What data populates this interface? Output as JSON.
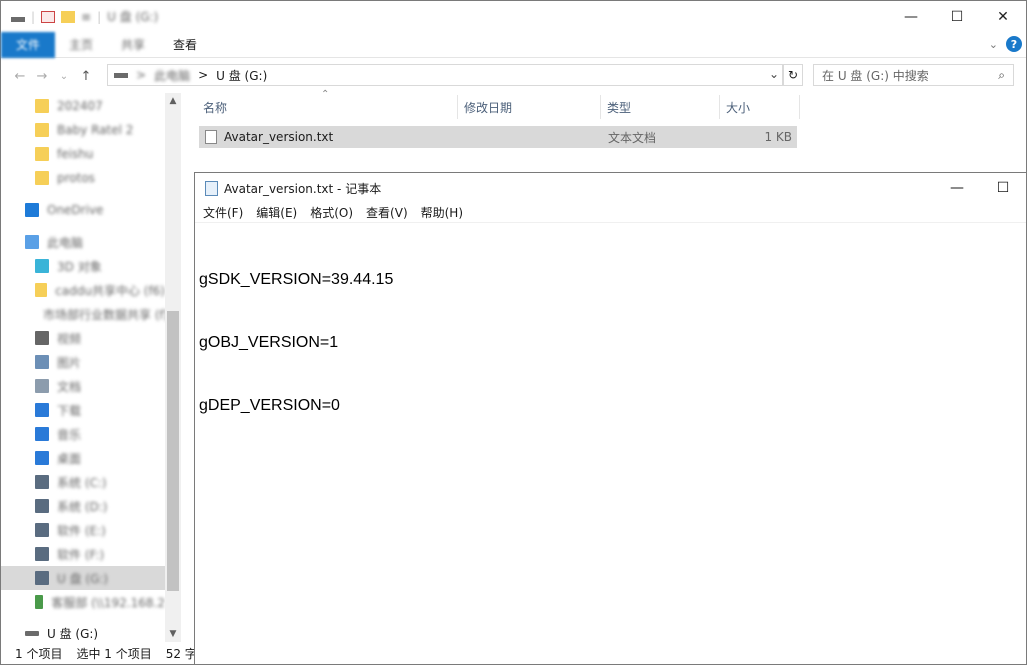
{
  "explorer": {
    "title_blurred": "U 盘 (G:)",
    "window_controls": {
      "minimize": "—",
      "maximize": "☐",
      "close": "✕"
    },
    "ribbon": {
      "tabs": [
        "文件",
        "主页",
        "共享",
        "查看"
      ]
    },
    "nav": {
      "back": "←",
      "forward": "→",
      "up_list": "⌄",
      "up": "↑"
    },
    "address": {
      "path_blurred": "此电脑",
      "current": "U 盘 (G:)",
      "separator": ">"
    },
    "search": {
      "placeholder": "在 U 盘 (G:) 中搜索"
    },
    "sidebar": {
      "items": [
        {
          "label": "202407",
          "icon": "folder-icon",
          "color": "#f6cf58"
        },
        {
          "label": "Baby Ratel 2",
          "icon": "folder-icon",
          "color": "#f6cf58"
        },
        {
          "label": "feishu",
          "icon": "folder-icon",
          "color": "#f6cf58"
        },
        {
          "label": "protos",
          "icon": "folder-icon",
          "color": "#f6cf58"
        },
        {
          "label": "OneDrive",
          "icon": "cloud-icon",
          "color": "#1e7bd8"
        },
        {
          "label": "此电脑",
          "icon": "computer-icon",
          "color": "#5aa0e6"
        },
        {
          "label": "3D 对象",
          "icon": "cube-icon",
          "color": "#3ab4d8"
        },
        {
          "label": "caddu共享中心 (f6)",
          "icon": "folder-icon",
          "color": "#f6cf58"
        },
        {
          "label": "市场部行业数据共享 (f)",
          "icon": "folder-icon",
          "color": "#f6cf58"
        },
        {
          "label": "视频",
          "icon": "video-icon",
          "color": "#666666"
        },
        {
          "label": "图片",
          "icon": "picture-icon",
          "color": "#6c8fb6"
        },
        {
          "label": "文档",
          "icon": "document-icon",
          "color": "#8c9cad"
        },
        {
          "label": "下载",
          "icon": "download-icon",
          "color": "#2a7ad8"
        },
        {
          "label": "音乐",
          "icon": "music-icon",
          "color": "#2a7ad8"
        },
        {
          "label": "桌面",
          "icon": "desktop-icon",
          "color": "#2a7ad8"
        },
        {
          "label": "系统 (C:)",
          "icon": "drive-icon",
          "color": "#5a6c80"
        },
        {
          "label": "系统 (D:)",
          "icon": "drive-icon",
          "color": "#5a6c80"
        },
        {
          "label": "软件 (E:)",
          "icon": "drive-icon",
          "color": "#5a6c80"
        },
        {
          "label": "软件 (F:)",
          "icon": "drive-icon",
          "color": "#5a6c80"
        },
        {
          "label": "U 盘 (G:)",
          "icon": "usb-drive-icon",
          "color": "#5a6c80"
        },
        {
          "label": "客服部 (\\\\192.168.2",
          "icon": "network-drive-icon",
          "color": "#4a9a4a"
        }
      ],
      "bottom_item": "U 盘 (G:)"
    },
    "columns": [
      "名称",
      "修改日期",
      "类型",
      "大小"
    ],
    "file": {
      "name": "Avatar_version.txt",
      "date": "",
      "type": "文本文档",
      "size": "1 KB"
    },
    "status": {
      "count": "1 个项目",
      "selected": "选中 1 个项目",
      "size": "52 字"
    }
  },
  "notepad": {
    "title": "Avatar_version.txt - 记事本",
    "menu": [
      "文件(F)",
      "编辑(E)",
      "格式(O)",
      "查看(V)",
      "帮助(H)"
    ],
    "lines": [
      "gSDK_VERSION=39.44.15",
      "gOBJ_VERSION=1",
      "gDEP_VERSION=0"
    ],
    "window_controls": {
      "minimize": "—",
      "maximize": "☐"
    }
  },
  "colors": {
    "accent": "#1979ca",
    "selection": "#d9d9d9"
  }
}
